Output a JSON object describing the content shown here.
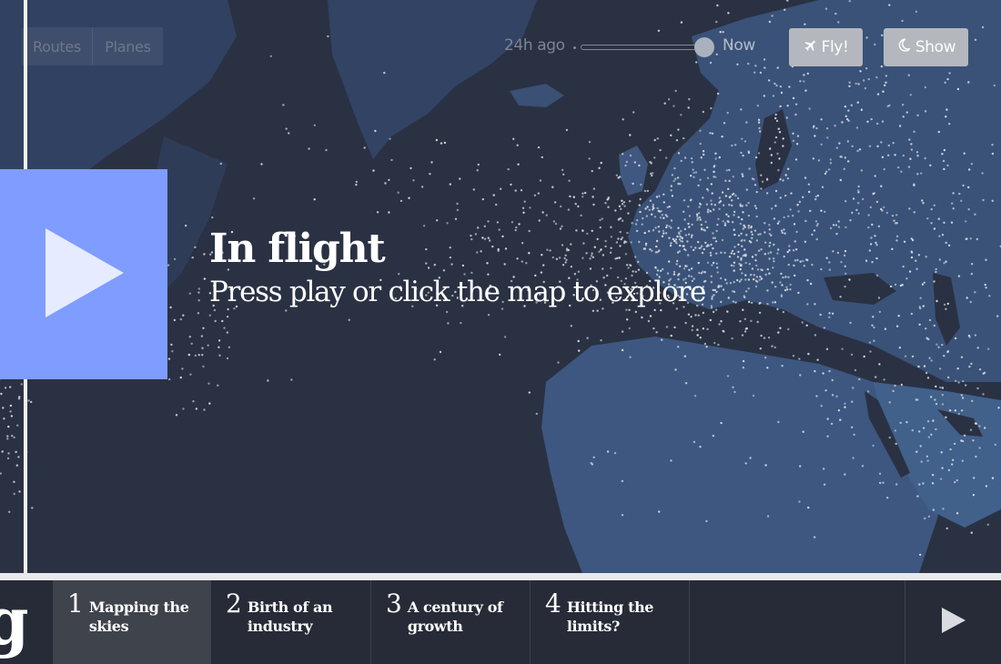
{
  "map": {
    "label": "World flight map"
  },
  "controls": {
    "mode_toggle": {
      "routes_label": "Routes",
      "planes_label": "Planes"
    },
    "time_slider": {
      "start_label": "24h ago",
      "end_label": "Now",
      "value_fraction": 1.0
    },
    "fly_button": {
      "label": "Fly!",
      "icon": "airplane-icon"
    },
    "show_button": {
      "label": "Show",
      "icon": "moon-icon"
    }
  },
  "intro": {
    "title": "In flight",
    "subtitle": "Press play or click the map to explore",
    "play_color": "#7f9cff"
  },
  "brand": {
    "logo_letter": "g"
  },
  "chapters": [
    {
      "number": "1",
      "title": "Mapping the skies",
      "active": true
    },
    {
      "number": "2",
      "title": "Birth of an industry",
      "active": false
    },
    {
      "number": "3",
      "title": "A century of growth",
      "active": false
    },
    {
      "number": "4",
      "title": "Hitting the limits?",
      "active": false
    }
  ],
  "colors": {
    "background": "#262c3b",
    "land": "#3c5478",
    "flight_dot": "#d8dce4",
    "button": "#b4b8be"
  }
}
